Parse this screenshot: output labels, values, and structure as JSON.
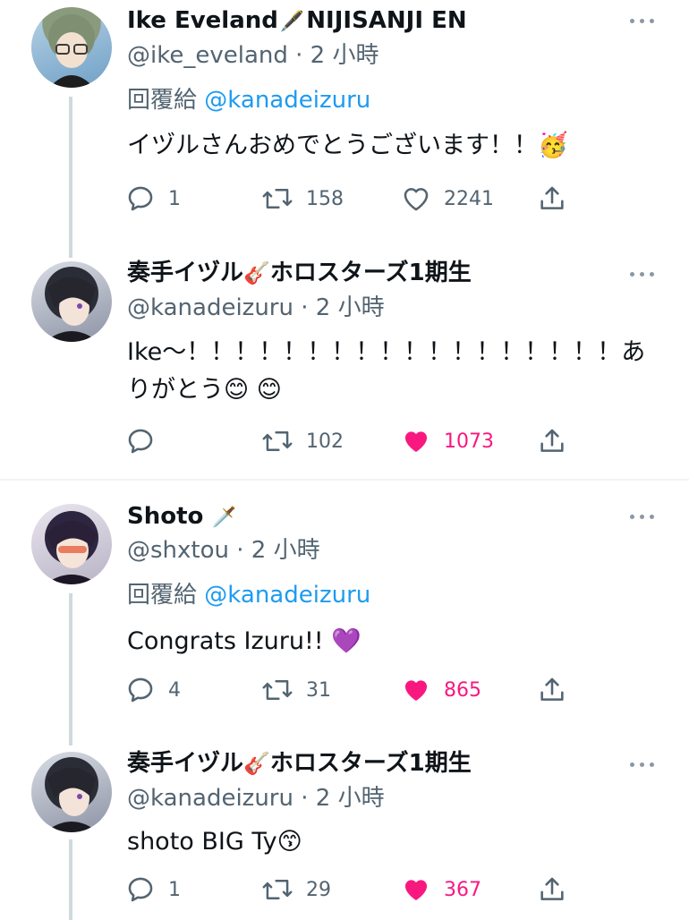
{
  "tweets": [
    {
      "name": "Ike Eveland",
      "name_suffix": "NIJISANJI EN",
      "name_emoji": "🖋️",
      "handle": "@ike_eveland",
      "time": "· 2 小時",
      "reply_prefix": "回覆給",
      "reply_to": "@kanadeizuru",
      "text": "イヅルさんおめでとうございます！！🥳",
      "replies": "1",
      "retweets": "158",
      "likes": "2241",
      "liked": false
    },
    {
      "name": "奏手イヅル",
      "name_emoji": "🎸",
      "name_suffix": "ホロスターズ1期生",
      "handle": "@kanadeizuru",
      "time": "· 2 小時",
      "text": "Ike～！！！！！！！！！！！！！！！！！！ありがとう😊 😊",
      "replies": "",
      "retweets": "102",
      "likes": "1073",
      "liked": true
    },
    {
      "name": "Shoto",
      "name_emoji": "🗡️",
      "handle": "@shxtou",
      "time": "· 2 小時",
      "reply_prefix": "回覆給",
      "reply_to": "@kanadeizuru",
      "text": "Congrats Izuru!! 💜",
      "replies": "4",
      "retweets": "31",
      "likes": "865",
      "liked": true
    },
    {
      "name": "奏手イヅル",
      "name_emoji": "🎸",
      "name_suffix": "ホロスターズ1期生",
      "handle": "@kanadeizuru",
      "time": "· 2 小時",
      "text": "shoto BIG Ty😙",
      "replies": "1",
      "retweets": "29",
      "likes": "367",
      "liked": true
    }
  ],
  "colors": {
    "like_active": "#f91880",
    "mention": "#1d9bf0",
    "secondary_text": "#536471",
    "thread_line": "#cfd9de"
  },
  "icons": [
    "reply-icon",
    "retweet-icon",
    "like-icon",
    "share-icon",
    "more-icon"
  ]
}
